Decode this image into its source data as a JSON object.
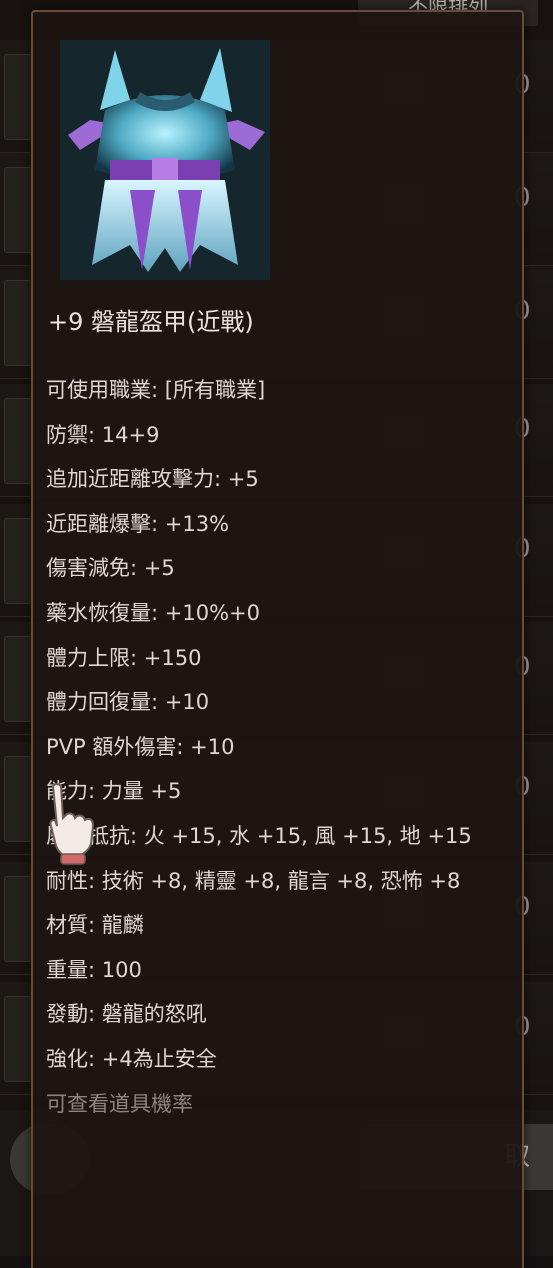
{
  "background": {
    "header_label": "不限排列",
    "rows": [
      {
        "ghost": "",
        "count": "0"
      },
      {
        "ghost": "",
        "count": "0"
      },
      {
        "ghost": "",
        "count": "0"
      },
      {
        "ghost": "",
        "count": "0"
      },
      {
        "ghost": "",
        "count": "0"
      },
      {
        "ghost": "",
        "count": "0"
      },
      {
        "ghost": "",
        "count": "0"
      },
      {
        "ghost": "",
        "count": "0"
      },
      {
        "ghost": "",
        "count": "0"
      }
    ],
    "right_button_label": "取"
  },
  "tooltip": {
    "item_name": "+9 磐龍盔甲(近戰)",
    "icon": "dragon-armor-icon",
    "stats": [
      "可使用職業: [所有職業]",
      "防禦: 14+9",
      "追加近距離攻擊力: +5",
      "近距離爆擊: +13%",
      "傷害減免: +5",
      "藥水恢復量: +10%+0",
      "體力上限: +150",
      "體力回復量: +10",
      "PVP 額外傷害: +10",
      "能力: 力量 +5",
      "屬性抵抗: 火 +15, 水 +15, 風 +15, 地 +15",
      "耐性: 技術 +8, 精靈 +8, 龍言 +8, 恐怖 +8",
      "材質: 龍麟",
      "重量: 100",
      "發動: 磐龍的怒吼",
      "強化: +4為止安全"
    ],
    "footer_note": "可查看道具機率"
  },
  "colors": {
    "tooltip_bg": "#1e1512",
    "tooltip_border": "#6a4a3b",
    "text": "#ded8d2",
    "muted": "#8c8580"
  }
}
